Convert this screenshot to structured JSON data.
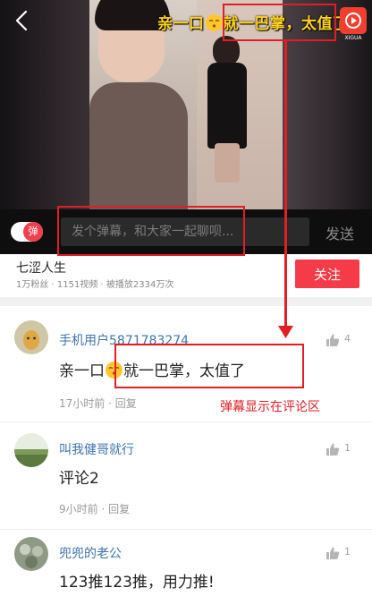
{
  "video": {
    "danmaku_overlay": {
      "before_emoji": "亲一口",
      "after_emoji": "就一巴掌，太值了"
    },
    "app_logo_caption": "XIGUA"
  },
  "danmaku_bar": {
    "toggle_label": "弹",
    "placeholder": "发个弹幕，和大家一起聊呗...",
    "send_label": "发送"
  },
  "channel": {
    "name": "七涩人生",
    "stats": "1万粉丝 · 1151视频 · 被播放2334万次",
    "follow_label": "关注"
  },
  "comments": [
    {
      "user": "手机用户5871783274",
      "text_before_emoji": "亲一口",
      "text_after_emoji": "就一巴掌，太值了",
      "time": "17小时前 · 回复",
      "likes": "4"
    },
    {
      "user": "叫我健哥就行",
      "text": "评论2",
      "time": "9小时前 · 回复",
      "likes": "1"
    },
    {
      "user": "兜兜的老公",
      "text": "123推123推，用力推!",
      "likes": "1"
    }
  ],
  "annotation": {
    "label": "弹幕显示在评论区"
  },
  "colors": {
    "accent_red": "#f43b47",
    "username_blue": "#3e74ad",
    "danmaku_yellow": "#ffd21f",
    "annotation_red": "#e01e24"
  }
}
